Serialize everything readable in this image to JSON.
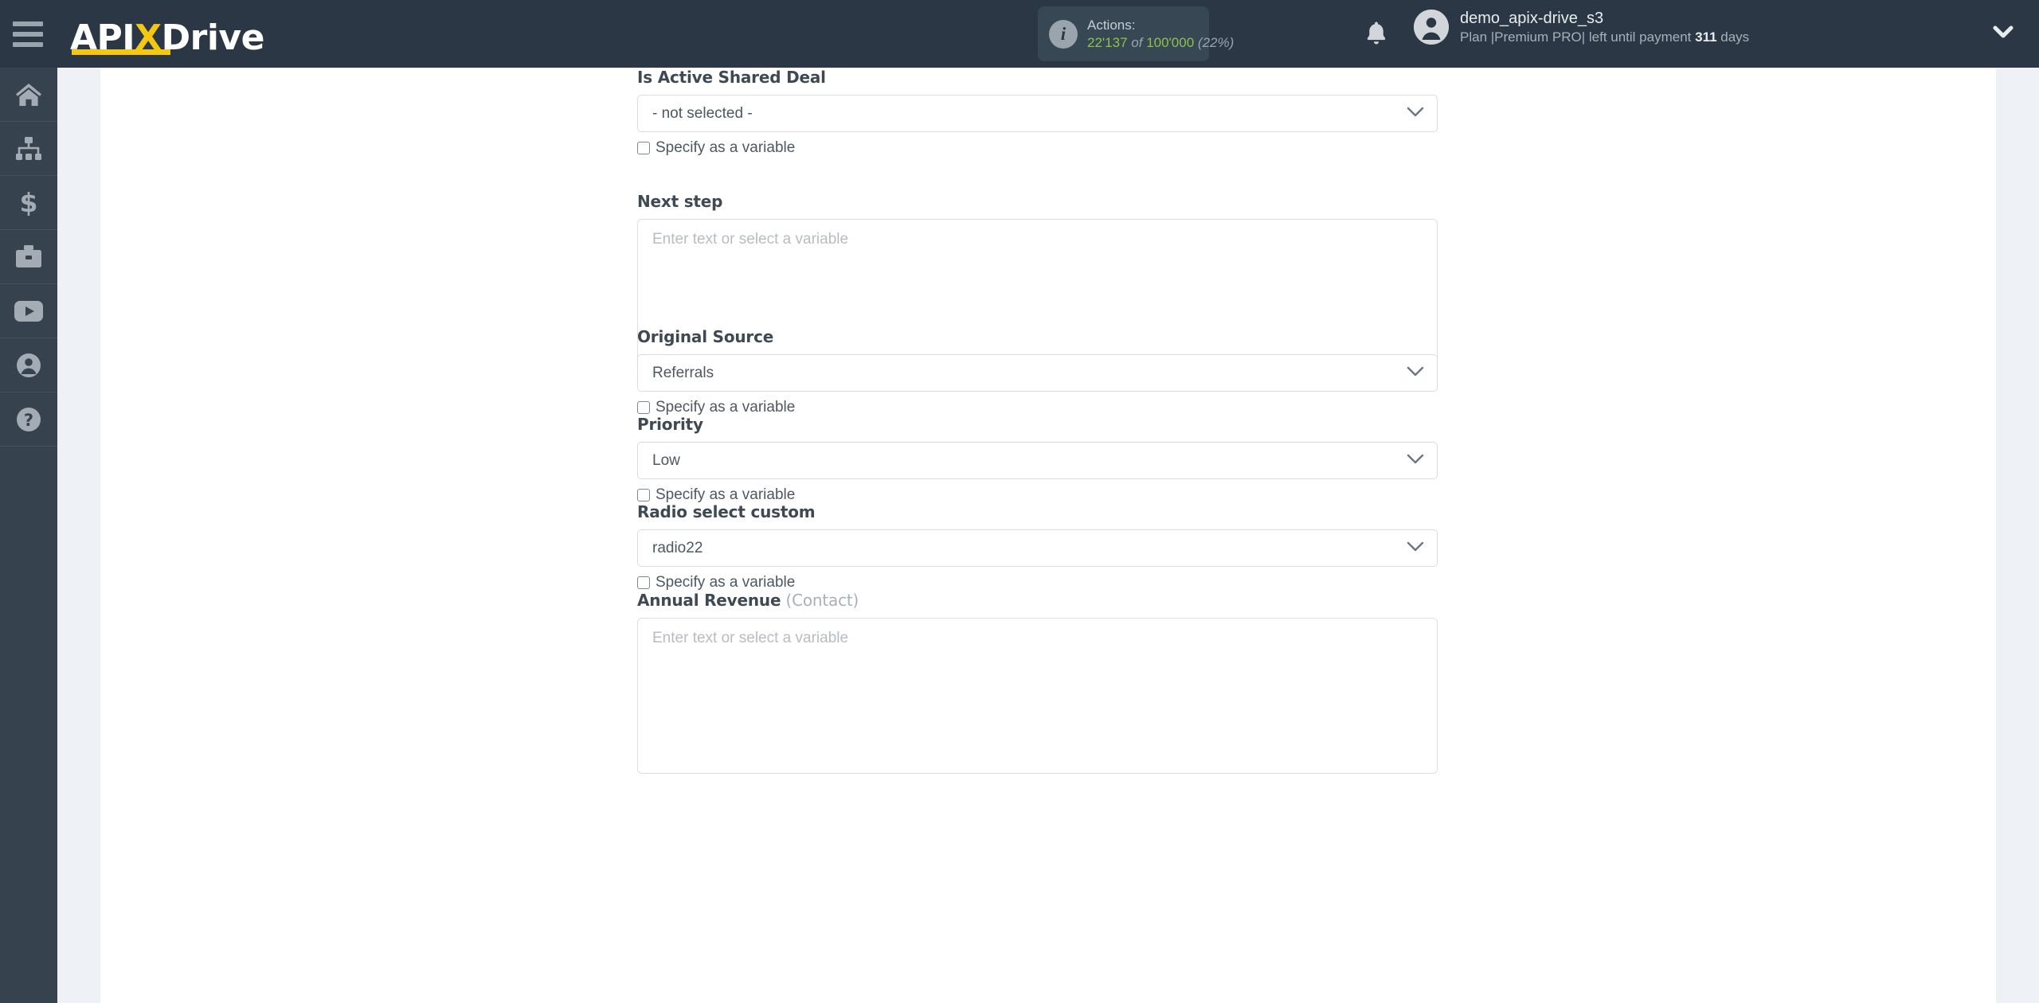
{
  "header": {
    "menu_icon": "hamburger-icon",
    "brand": {
      "part1": "API",
      "x": "X",
      "part2": "Drive"
    },
    "actions": {
      "info_icon": "info-icon",
      "title": "Actions:",
      "used": "22'137",
      "separator": "of",
      "total": "100'000",
      "percent": "(22%)"
    },
    "bell_icon": "bell-icon",
    "user": {
      "avatar_icon": "user-avatar-icon",
      "name": "demo_apix-drive_s3",
      "plan_prefix": "Plan |Premium PRO| left until payment ",
      "plan_days": "311",
      "plan_suffix": " days"
    },
    "caret_icon": "chevron-down-icon"
  },
  "sidebar": {
    "items": [
      {
        "icon": "home-icon",
        "name": "sidebar-item-home"
      },
      {
        "icon": "sitemap-icon",
        "name": "sidebar-item-connections"
      },
      {
        "icon": "dollar-icon",
        "name": "sidebar-item-payments"
      },
      {
        "icon": "briefcase-icon",
        "name": "sidebar-item-business"
      },
      {
        "icon": "youtube-icon",
        "name": "sidebar-item-video"
      },
      {
        "icon": "account-icon",
        "name": "sidebar-item-account"
      },
      {
        "icon": "question-icon",
        "name": "sidebar-item-help"
      }
    ]
  },
  "form": {
    "variable_checkbox_label": "Specify as a variable",
    "fields": [
      {
        "label": "Is Active Shared Deal",
        "type": "select",
        "value": "- not selected -",
        "has_checkbox": true
      },
      {
        "label": "Next step",
        "type": "textarea",
        "value": "",
        "placeholder": "Enter text or select a variable",
        "has_checkbox": false
      },
      {
        "label": "Original Source",
        "type": "select",
        "value": "Referrals",
        "has_checkbox": true
      },
      {
        "label": "Priority",
        "type": "select",
        "value": "Low",
        "has_checkbox": true
      },
      {
        "label": "Radio select custom",
        "type": "select",
        "value": "radio22",
        "has_checkbox": true
      },
      {
        "label": "Annual Revenue",
        "label_sub": " (Contact)",
        "type": "textarea",
        "value": "",
        "placeholder": "Enter text or select a variable",
        "has_checkbox": false
      }
    ]
  },
  "colors": {
    "header_bg": "#2b3744",
    "sidebar_bg": "#36434f",
    "page_bg": "#eef2f7",
    "brand_yellow": "#f4c712",
    "accent_green": "#8bc34a"
  }
}
